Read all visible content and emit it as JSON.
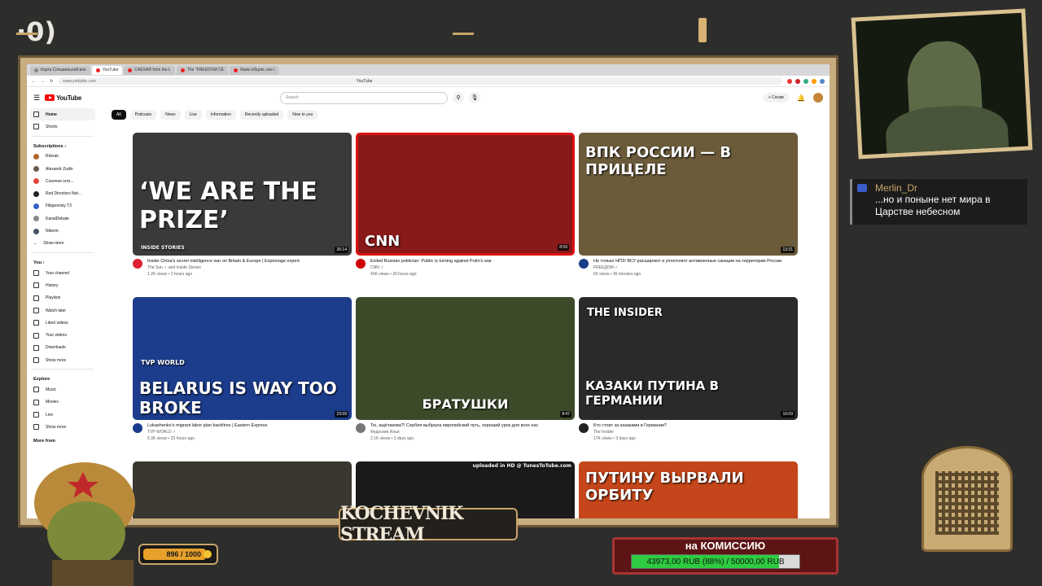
{
  "overlay": {
    "stream_name": "KOCHEVNIK STREAM",
    "top_logo": "·0)",
    "xp": {
      "text": "896 / 1000",
      "fraction": 0.896
    },
    "chat": {
      "user": "Merlin_Dr",
      "message": "...но и поныне нет мира в Царстве небесном"
    },
    "donation": {
      "title": "на КОМИССИЮ",
      "progress_text": "43973,00 RUB (88%) / 50000,00 RUB",
      "fraction": 0.88
    }
  },
  "browser": {
    "tabs": [
      {
        "label": "Карта Специальной вое"
      },
      {
        "label": "YouTube",
        "active": true
      },
      {
        "label": "CAESAR from the L"
      },
      {
        "label": "The \"FREEDOM CE"
      },
      {
        "label": "Яким обіцяю, кое і"
      }
    ],
    "url": "www.youtube.com",
    "page_title": "YouTube"
  },
  "youtube": {
    "logo": "YouTube",
    "search_placeholder": "Search",
    "create_label": "+ Create",
    "sidebar": {
      "main": [
        {
          "label": "Home",
          "active": true
        },
        {
          "label": "Shorts"
        }
      ],
      "subscriptions_header": "Subscriptions  ›",
      "subscriptions": [
        {
          "label": "Rokrak",
          "color": "#b0682a"
        },
        {
          "label": "Alexandr Zudin",
          "color": "#6a5a4a"
        },
        {
          "label": "Сонячне інте...",
          "color": "#e0463a"
        },
        {
          "label": "Red Directors Net...",
          "color": "#222222"
        },
        {
          "label": "Filippovsky T3",
          "color": "#3264c8"
        },
        {
          "label": "KanalDebate",
          "color": "#888888"
        },
        {
          "label": "Nikerm",
          "color": "#445566"
        }
      ],
      "show_more": "Show more",
      "you_header": "You  ›",
      "you_items": [
        {
          "label": "Your channel"
        },
        {
          "label": "History"
        },
        {
          "label": "Playlists"
        },
        {
          "label": "Watch later"
        },
        {
          "label": "Liked videos"
        },
        {
          "label": "Your videos"
        },
        {
          "label": "Downloads"
        },
        {
          "label": "Show more"
        }
      ],
      "explore_header": "Explore",
      "explore_items": [
        {
          "label": "Music"
        },
        {
          "label": "Movies"
        },
        {
          "label": "Live"
        },
        {
          "label": "Show more"
        }
      ],
      "more_from": "More from"
    },
    "chips": [
      "All",
      "Podcasts",
      "News",
      "Live",
      "Information",
      "Recently uploaded",
      "New to you"
    ],
    "videos": [
      {
        "title": "Inside China's secret intelligence war on Britain & Europe | Espionage expert",
        "channel": "The Sun ✓ and Inside Stories",
        "stats": "1.2K views • 2 hours ago",
        "duration": "26:14",
        "thumb_text": "‘WE ARE THE PRIZE’",
        "thumb_sub": "INSIDE STORIES",
        "bg": "#3a3a3a",
        "av": "#d23"
      },
      {
        "title": "Exiled Russian politician: Public is turning against Putin's war",
        "channel": "CNN ✓",
        "stats": "43K views • 20 hours ago",
        "duration": "8:59",
        "thumb_text": "CNN",
        "thumb_sub": "",
        "bg": "#8a1a1a",
        "av": "#c00"
      },
      {
        "title": "Не только НПЗ! ВСУ расширяют и уплотняют антивоенные санкции на территории России",
        "channel": "FREEДОМ ✓",
        "stats": "60 views • 36 minutes ago",
        "duration": "13:31",
        "thumb_text": "ВПК РОССИИ — В ПРИЦЕЛЕ",
        "thumb_sub": "",
        "bg": "#6b5b3a",
        "av": "#1a3c8c"
      },
      {
        "title": "Lukashenko's migrant labor plan backfires | Eastern Express",
        "channel": "TVP WORLD ✓",
        "stats": "5.3K views • 22 hours ago",
        "duration": "23:09",
        "thumb_text": "BELARUS IS WAY TOO BROKE",
        "thumb_sub": "TVP WORLD",
        "bg": "#1c3c8c",
        "av": "#1a3c8c"
      },
      {
        "title": "Тю, ащётакова?! Сербия выбрала европейский путь, хороший урок для всех нас",
        "channel": "Федоскин Илья",
        "stats": "2.1K views • 3 days ago",
        "duration": "8:47",
        "thumb_text": "БРАТУШКИ",
        "thumb_sub": "",
        "bg": "#3d4a2a",
        "av": "#777"
      },
      {
        "title": "Кто стоит за казаками в Германии?",
        "channel": "The Insider",
        "stats": "17K views • 3 days ago",
        "duration": "10:09",
        "thumb_text": "КАЗАКИ ПУТИНА В ГЕРМАНИИ",
        "thumb_sub": "THE INSIDER",
        "bg": "#2a2a2a",
        "av": "#222"
      },
      {
        "title": "",
        "channel": "",
        "stats": "",
        "duration": "",
        "thumb_text": "",
        "thumb_sub": "",
        "bg": "#3a3630",
        "av": "#555"
      },
      {
        "title": "",
        "channel": "",
        "stats": "",
        "duration": "",
        "thumb_text": "",
        "thumb_sub": "uploaded in HD @ TunesToTube.com",
        "bg": "#1a1a1a",
        "av": "#555"
      },
      {
        "title": "",
        "channel": "",
        "stats": "",
        "duration": "",
        "thumb_text": "ПУТИНУ ВЫРВАЛИ ОРБИТУ",
        "thumb_sub": "",
        "bg": "#c4461a",
        "av": "#555"
      }
    ]
  }
}
